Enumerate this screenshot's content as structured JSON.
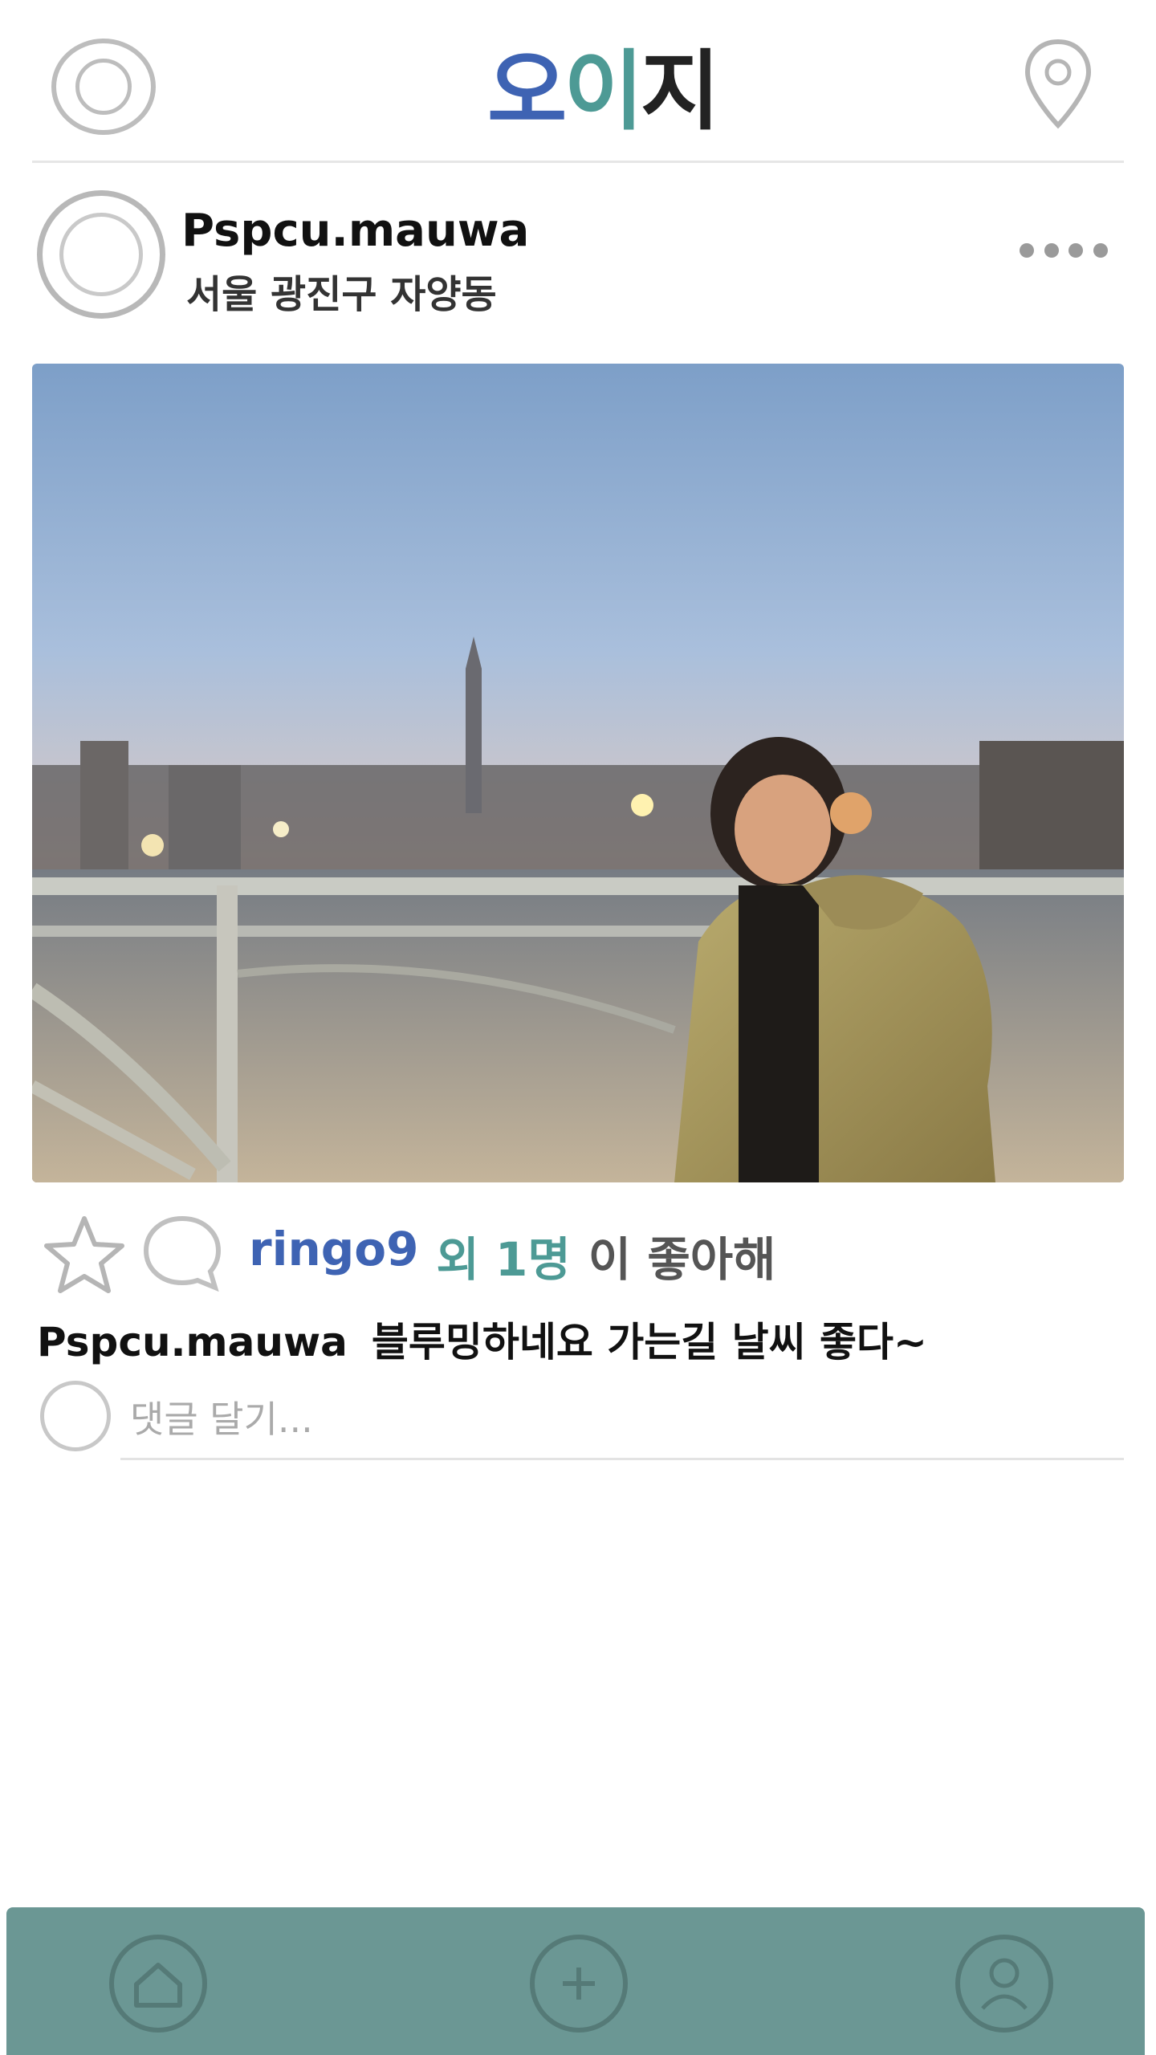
{
  "app": {
    "logo_part1": "오",
    "logo_part2": "이",
    "logo_part3": "지"
  },
  "post": {
    "username": "Pspcu.mauwa",
    "location": "서울 광진구 자양동",
    "likes": {
      "user": "ringo9",
      "others": "외 1명",
      "suffix": "이 좋아해"
    },
    "caption_user": "Pspcu.mauwa",
    "caption_text": "블루밍하네요 가는길 날씨 좋다~"
  },
  "comment": {
    "placeholder": "댓글 달기..."
  },
  "colors": {
    "brand_blue": "#3e63b3",
    "brand_teal": "#4d9a95",
    "nav_bg": "#6b9794"
  }
}
